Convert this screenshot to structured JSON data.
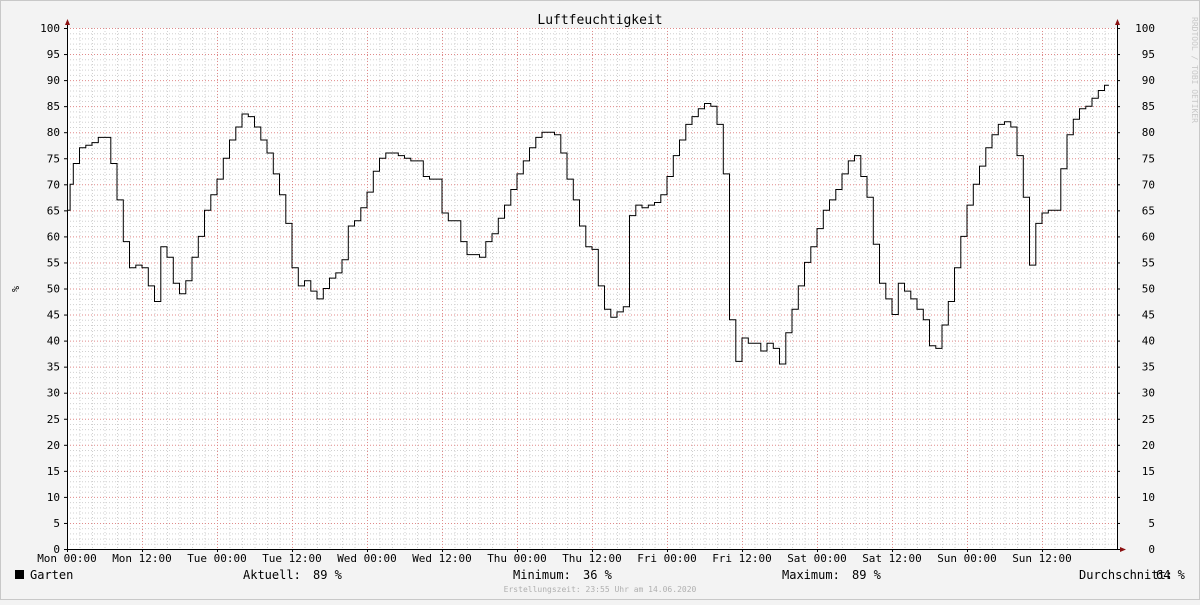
{
  "chart_data": {
    "type": "line",
    "title": "Luftfeuchtigkeit",
    "ylabel": "%",
    "ylim": [
      0,
      100
    ],
    "y_ticks": [
      0,
      5,
      10,
      15,
      20,
      25,
      30,
      35,
      40,
      45,
      50,
      55,
      60,
      65,
      70,
      75,
      80,
      85,
      90,
      95,
      100
    ],
    "x_unit": "hours since Mon 00:00",
    "xlim": [
      0,
      168
    ],
    "x_ticks": [
      {
        "label": "Mon 00:00",
        "x": 0
      },
      {
        "label": "Mon 12:00",
        "x": 12
      },
      {
        "label": "Tue 00:00",
        "x": 24
      },
      {
        "label": "Tue 12:00",
        "x": 36
      },
      {
        "label": "Wed 00:00",
        "x": 48
      },
      {
        "label": "Wed 12:00",
        "x": 60
      },
      {
        "label": "Thu 00:00",
        "x": 72
      },
      {
        "label": "Thu 12:00",
        "x": 84
      },
      {
        "label": "Fri 00:00",
        "x": 96
      },
      {
        "label": "Fri 12:00",
        "x": 108
      },
      {
        "label": "Sat 00:00",
        "x": 120
      },
      {
        "label": "Sat 12:00",
        "x": 132
      },
      {
        "label": "Sun 00:00",
        "x": 144
      },
      {
        "label": "Sun 12:00",
        "x": 156
      }
    ],
    "grid": true,
    "series": [
      {
        "name": "Garten",
        "color": "#000000",
        "style": "step",
        "points": [
          [
            0,
            65
          ],
          [
            0.5,
            70
          ],
          [
            1,
            74
          ],
          [
            2,
            77
          ],
          [
            3,
            77.5
          ],
          [
            4,
            78
          ],
          [
            5,
            79
          ],
          [
            6,
            79
          ],
          [
            7,
            74
          ],
          [
            8,
            67
          ],
          [
            9,
            59
          ],
          [
            10,
            54
          ],
          [
            11,
            54.5
          ],
          [
            12,
            54
          ],
          [
            13,
            50.5
          ],
          [
            14,
            47.5
          ],
          [
            15,
            58
          ],
          [
            16,
            56
          ],
          [
            17,
            51
          ],
          [
            18,
            49
          ],
          [
            19,
            51.5
          ],
          [
            20,
            56
          ],
          [
            21,
            60
          ],
          [
            22,
            65
          ],
          [
            23,
            68
          ],
          [
            24,
            71
          ],
          [
            25,
            75
          ],
          [
            26,
            78.5
          ],
          [
            27,
            81
          ],
          [
            28,
            83.5
          ],
          [
            29,
            83
          ],
          [
            30,
            81
          ],
          [
            31,
            78.5
          ],
          [
            32,
            76
          ],
          [
            33,
            72
          ],
          [
            34,
            68
          ],
          [
            35,
            62.5
          ],
          [
            36,
            54
          ],
          [
            37,
            50.5
          ],
          [
            38,
            51.5
          ],
          [
            39,
            49.5
          ],
          [
            40,
            48
          ],
          [
            41,
            50
          ],
          [
            42,
            52
          ],
          [
            43,
            53
          ],
          [
            44,
            55.5
          ],
          [
            45,
            62
          ],
          [
            46,
            63
          ],
          [
            47,
            65.5
          ],
          [
            48,
            68.5
          ],
          [
            49,
            72.5
          ],
          [
            50,
            75
          ],
          [
            51,
            76
          ],
          [
            52,
            76
          ],
          [
            53,
            75.5
          ],
          [
            54,
            75
          ],
          [
            55,
            74.5
          ],
          [
            56,
            74.5
          ],
          [
            57,
            71.5
          ],
          [
            58,
            71
          ],
          [
            59,
            71
          ],
          [
            60,
            64.5
          ],
          [
            61,
            63
          ],
          [
            62,
            63
          ],
          [
            63,
            59
          ],
          [
            64,
            56.5
          ],
          [
            65,
            56.5
          ],
          [
            66,
            56
          ],
          [
            67,
            59
          ],
          [
            68,
            60.5
          ],
          [
            69,
            63.5
          ],
          [
            70,
            66
          ],
          [
            71,
            69
          ],
          [
            72,
            72
          ],
          [
            73,
            74.5
          ],
          [
            74,
            77
          ],
          [
            75,
            79
          ],
          [
            76,
            80
          ],
          [
            77,
            80
          ],
          [
            78,
            79.5
          ],
          [
            79,
            76
          ],
          [
            80,
            71
          ],
          [
            81,
            67
          ],
          [
            82,
            62
          ],
          [
            83,
            58
          ],
          [
            84,
            57.5
          ],
          [
            85,
            50.5
          ],
          [
            86,
            46
          ],
          [
            87,
            44.5
          ],
          [
            88,
            45.5
          ],
          [
            89,
            46.5
          ],
          [
            90,
            64
          ],
          [
            91,
            66
          ],
          [
            92,
            65.5
          ],
          [
            93,
            66
          ],
          [
            94,
            66.5
          ],
          [
            95,
            68
          ],
          [
            96,
            71.5
          ],
          [
            97,
            75.5
          ],
          [
            98,
            78.5
          ],
          [
            99,
            81.5
          ],
          [
            100,
            83
          ],
          [
            101,
            84.5
          ],
          [
            102,
            85.5
          ],
          [
            103,
            85
          ],
          [
            104,
            81.5
          ],
          [
            105,
            72
          ],
          [
            106,
            44
          ],
          [
            107,
            36
          ],
          [
            108,
            40.5
          ],
          [
            109,
            39.5
          ],
          [
            110,
            39.5
          ],
          [
            111,
            38
          ],
          [
            112,
            39.5
          ],
          [
            113,
            38.5
          ],
          [
            114,
            35.5
          ],
          [
            115,
            41.5
          ],
          [
            116,
            46
          ],
          [
            117,
            50.5
          ],
          [
            118,
            55
          ],
          [
            119,
            58
          ],
          [
            120,
            61.5
          ],
          [
            121,
            65
          ],
          [
            122,
            67
          ],
          [
            123,
            69
          ],
          [
            124,
            72
          ],
          [
            125,
            74.5
          ],
          [
            126,
            75.5
          ],
          [
            127,
            71.5
          ],
          [
            128,
            67.5
          ],
          [
            129,
            58.5
          ],
          [
            130,
            51
          ],
          [
            131,
            48
          ],
          [
            132,
            45
          ],
          [
            133,
            51
          ],
          [
            134,
            49.5
          ],
          [
            135,
            48
          ],
          [
            136,
            46
          ],
          [
            137,
            44
          ],
          [
            138,
            39
          ],
          [
            139,
            38.5
          ],
          [
            140,
            43
          ],
          [
            141,
            47.5
          ],
          [
            142,
            54
          ],
          [
            143,
            60
          ],
          [
            144,
            66
          ],
          [
            145,
            70
          ],
          [
            146,
            73.5
          ],
          [
            147,
            77
          ],
          [
            148,
            79.5
          ],
          [
            149,
            81.5
          ],
          [
            150,
            82
          ],
          [
            151,
            81
          ],
          [
            152,
            75.5
          ],
          [
            153,
            67.5
          ],
          [
            154,
            54.5
          ],
          [
            155,
            62.5
          ],
          [
            156,
            64.5
          ],
          [
            157,
            65
          ],
          [
            158,
            65
          ],
          [
            159,
            73
          ],
          [
            160,
            79.5
          ],
          [
            161,
            82.5
          ],
          [
            162,
            84.5
          ],
          [
            163,
            85
          ],
          [
            164,
            86.5
          ],
          [
            165,
            88
          ],
          [
            166,
            89
          ],
          [
            166.7,
            89
          ]
        ]
      }
    ],
    "watermark": "RRDTOOL / TOBI OETIKER"
  },
  "legend": {
    "series_name": "Garten",
    "series_color": "#000000",
    "current_label": "Aktuell:",
    "current_value": "89 %",
    "min_label": "Minimum:",
    "min_value": "36 %",
    "max_label": "Maximum:",
    "max_value": "89 %",
    "avg_label": "Durchschnitt:",
    "avg_value": "64 %"
  },
  "footer": "Erstellungszeit: 23:55 Uhr am 14.06.2020",
  "colors": {
    "background": "#f3f3f3",
    "plot_background": "#ffffff",
    "major_grid": "#e08a8a",
    "minor_grid": "#d0d0d0",
    "axis": "#000000",
    "arrow": "#8b1010"
  }
}
